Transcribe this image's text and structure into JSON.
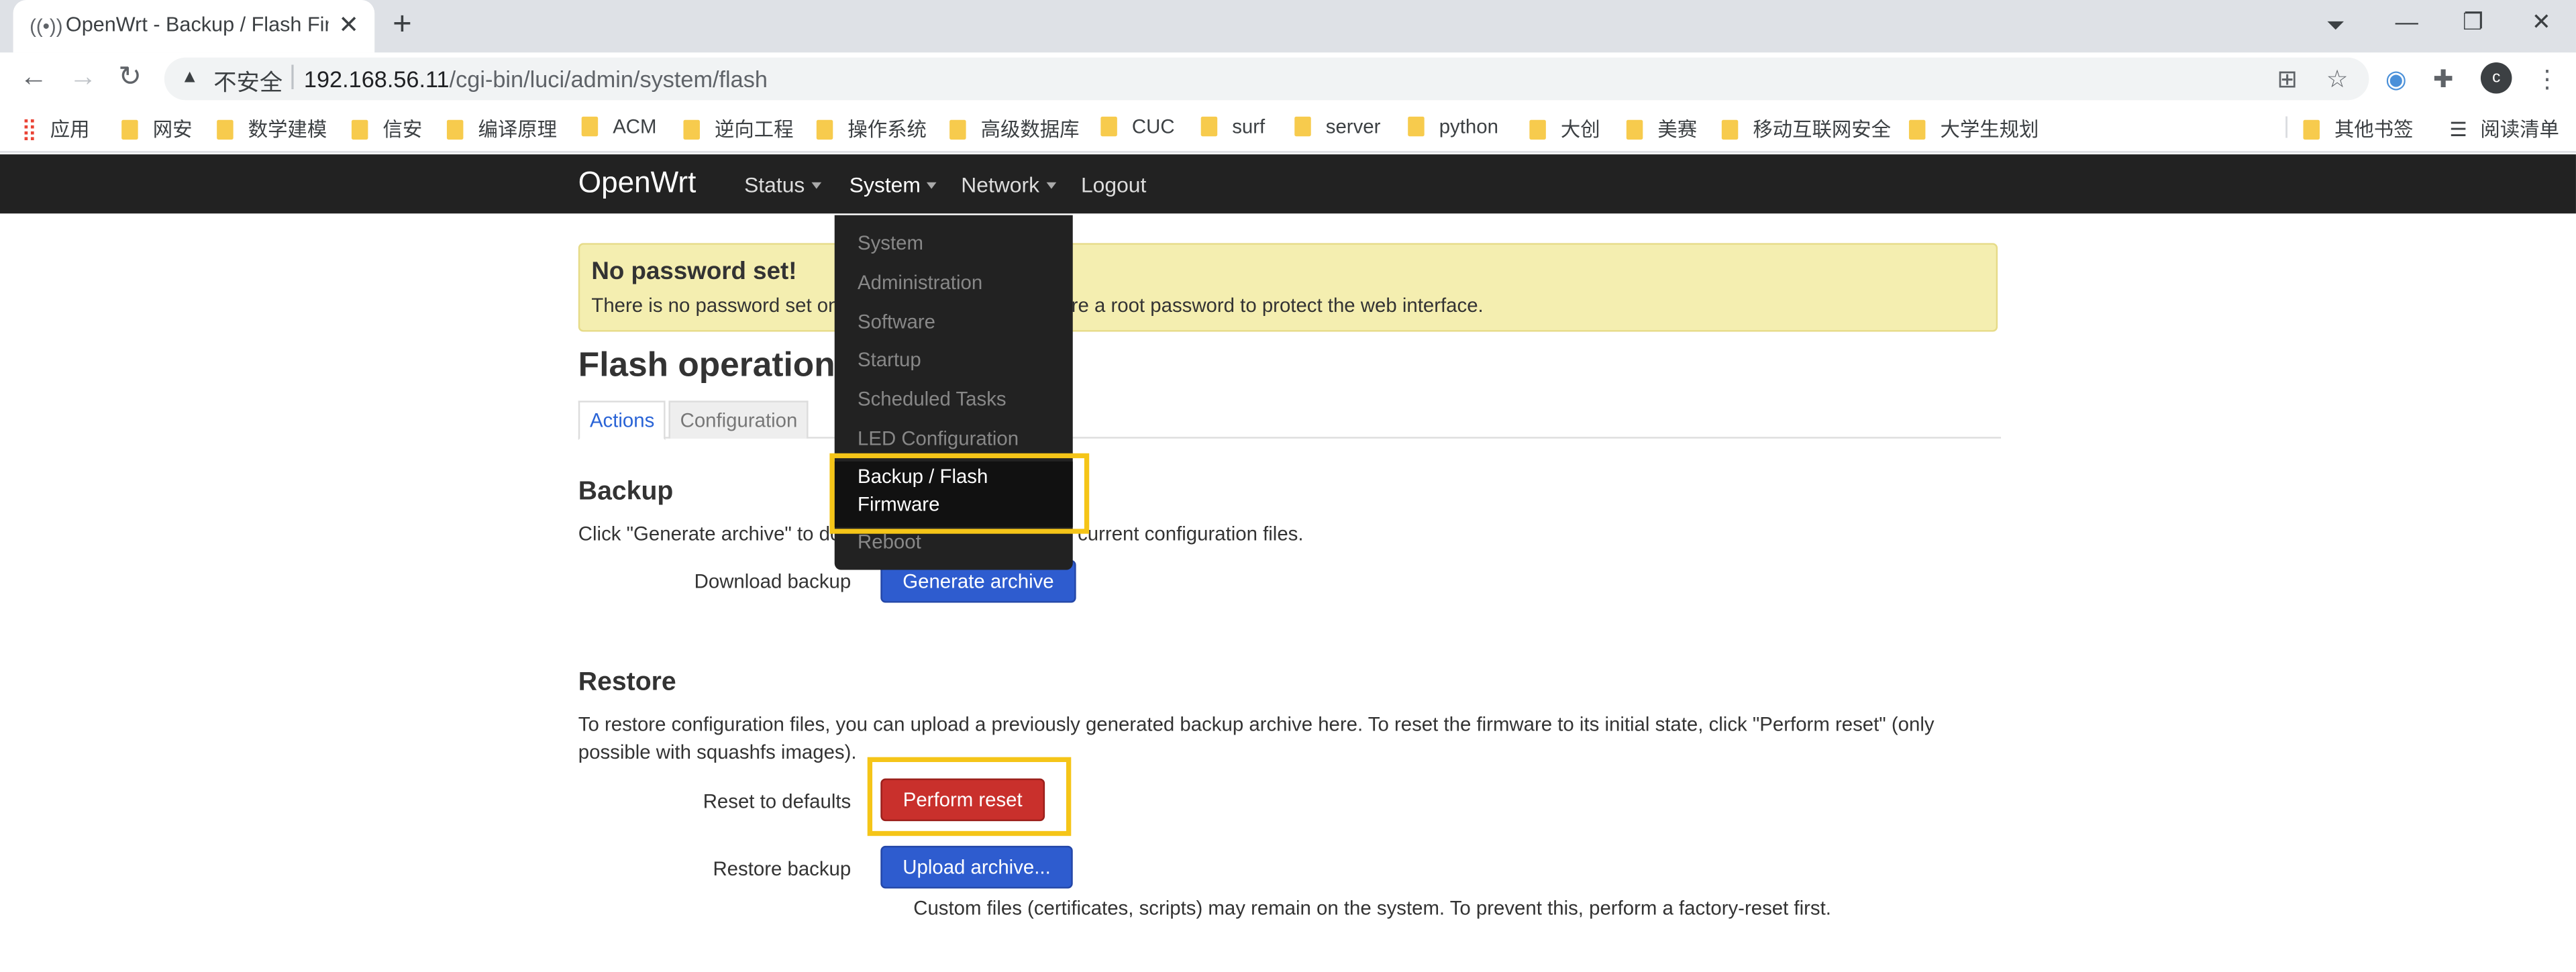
{
  "browser": {
    "tab_title": "OpenWrt - Backup / Flash Firm",
    "insecure_label": "不安全",
    "url_host": "192.168.56.11",
    "url_path": "/cgi-bin/luci/admin/system/flash",
    "avatar_letter": "c",
    "bookmarks": [
      "应用",
      "网安",
      "数学建模",
      "信安",
      "编译原理",
      "ACM",
      "逆向工程",
      "操作系统",
      "高级数据库",
      "CUC",
      "surf",
      "server",
      "python",
      "大创",
      "美赛",
      "移动互联网安全",
      "大学生规划"
    ],
    "other_bookmarks": "其他书签",
    "reading_list": "阅读清单"
  },
  "nav": {
    "brand": "OpenWrt",
    "status": "Status",
    "system": "System",
    "network": "Network",
    "logout": "Logout"
  },
  "dropdown": [
    "System",
    "Administration",
    "Software",
    "Startup",
    "Scheduled Tasks",
    "LED Configuration",
    "Backup / Flash",
    "Firmware",
    "Reboot"
  ],
  "alert": {
    "title": "No password set!",
    "text": "There is no password set on this router. Please configure a root password to protect the web interface."
  },
  "page": {
    "title": "Flash operations",
    "tabs": [
      "Actions",
      "Configuration"
    ],
    "backup": {
      "heading": "Backup",
      "desc": "Click \"Generate archive\" to download a tar archive of the current configuration files.",
      "label": "Download backup",
      "button": "Generate archive"
    },
    "restore": {
      "heading": "Restore",
      "desc_line1": "To restore configuration files, you can upload a previously generated backup archive here. To reset the firmware to its initial state, click \"Perform reset\" (only",
      "desc_line2": "possible with squashfs images).",
      "reset_label": "Reset to defaults",
      "reset_button": "Perform reset",
      "restore_label": "Restore backup",
      "upload_button": "Upload archive...",
      "note": "Custom files (certificates, scripts) may remain on the system. To prevent this, perform a factory-reset first."
    }
  },
  "colors": {
    "highlight": "#f5c518",
    "primary": "#2e5ccf",
    "danger": "#c9302c"
  }
}
